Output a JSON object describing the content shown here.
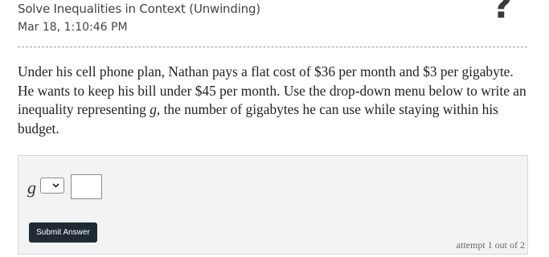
{
  "header": {
    "title": "Solve Inequalities in Context (Unwinding)",
    "date": "Mar 18, 1:10:46 PM",
    "help_icon": "question-mark-icon"
  },
  "question": {
    "part1": "Under his cell phone plan, Nathan pays a flat cost of $36 per month and $3 per gigabyte. He wants to keep his bill under $45 per month. Use the drop-down menu below to write an inequality representing ",
    "variable": "g",
    "part2": ", the number of gigabytes he can use while staying within his budget."
  },
  "answer": {
    "variable_label": "g",
    "dropdown_selected": "",
    "input_value": "",
    "submit_label": "Submit Answer",
    "attempt_text": "attempt 1 out of 2"
  }
}
